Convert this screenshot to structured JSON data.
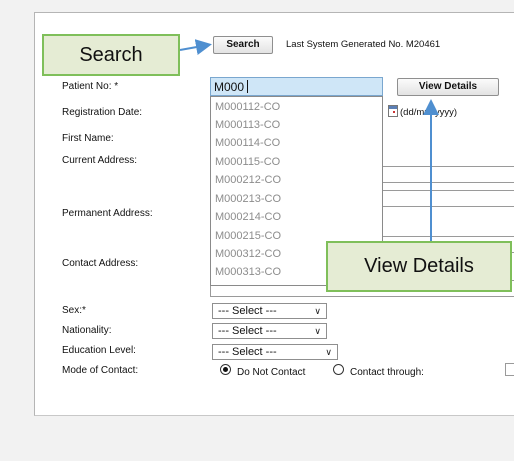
{
  "callouts": {
    "search": "Search",
    "view_details": "View Details"
  },
  "toolbar": {
    "search_label": "Search",
    "last_generated": "Last System Generated No. M20461"
  },
  "form": {
    "patient_no_label": "Patient No: *",
    "patient_no_value": "M000",
    "view_details_label": "View Details",
    "registration_date_label": "Registration Date:",
    "date_format_hint": "(dd/mm/yyyy)",
    "first_name_label": "First Name:",
    "current_address_label": "Current Address:",
    "permanent_address_label": "Permanent Address:",
    "contact_address_label": "Contact Address:",
    "sex_label": "Sex:*",
    "nationality_label": "Nationality:",
    "education_label": "Education Level:",
    "mode_of_contact_label": "Mode of Contact:",
    "select_placeholder": "--- Select ---",
    "do_not_contact_label": "Do Not Contact",
    "contact_through_label": "Contact through:"
  },
  "suggestions": [
    "M000112-CO",
    "M000113-CO",
    "M000114-CO",
    "M000115-CO",
    "M000212-CO",
    "M000213-CO",
    "M000214-CO",
    "M000215-CO",
    "M000312-CO",
    "M000313-CO"
  ],
  "colors": {
    "callout_fill": "#e5ecd4",
    "callout_border": "#7fbf5a",
    "arrow": "#4f8fd0",
    "input_highlight": "#cfe6f7"
  }
}
